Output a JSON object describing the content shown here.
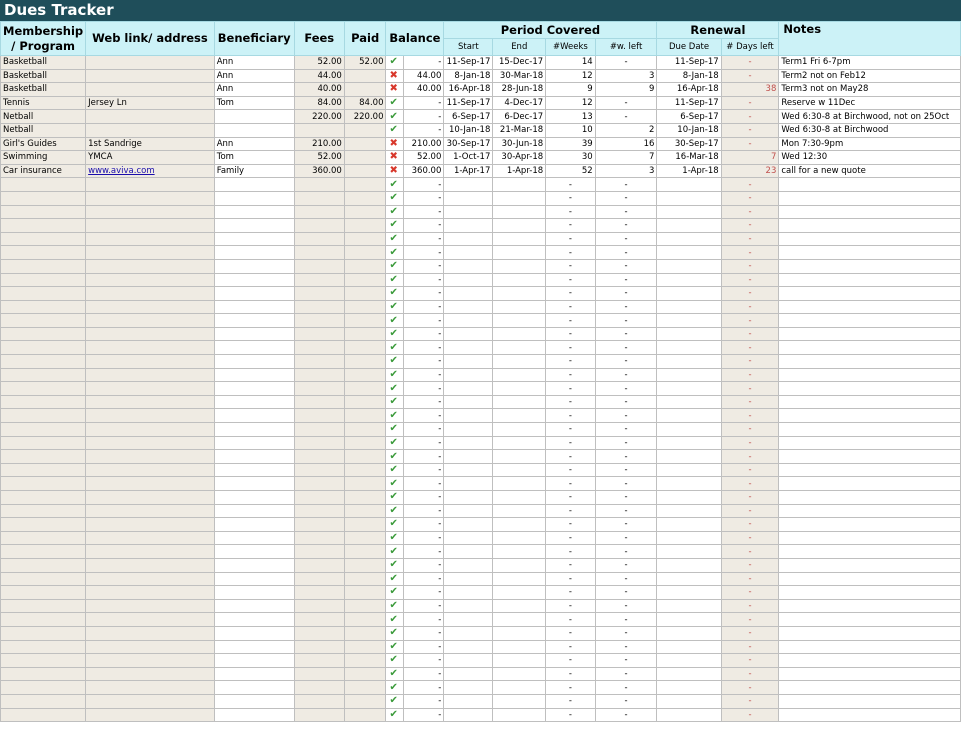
{
  "title": "Dues Tracker",
  "headers": {
    "membership": "Membership / Program",
    "web": "Web link/ address",
    "beneficiary": "Beneficiary",
    "fees": "Fees",
    "paid": "Paid",
    "balance": "Balance",
    "period": "Period Covered",
    "start": "Start",
    "end": "End",
    "weeks": "#Weeks",
    "wleft": "#w. left",
    "renewal": "Renewal",
    "due": "Due Date",
    "daysleft": "# Days left",
    "notes": "Notes"
  },
  "rows": [
    {
      "program": "Basketball",
      "web": "",
      "beneficiary": "Ann",
      "fees": "52.00",
      "paid": "52.00",
      "status": "check",
      "balance": "-",
      "start": "11-Sep-17",
      "end": "15-Dec-17",
      "weeks": "14",
      "wleft": "-",
      "due": "11-Sep-17",
      "days": "-",
      "notes": "Term1 Fri 6-7pm"
    },
    {
      "program": "Basketball",
      "web": "",
      "beneficiary": "Ann",
      "fees": "44.00",
      "paid": "",
      "status": "cross",
      "balance": "44.00",
      "start": "8-Jan-18",
      "end": "30-Mar-18",
      "weeks": "12",
      "wleft": "3",
      "due": "8-Jan-18",
      "days": "-",
      "notes": "Term2 not on Feb12"
    },
    {
      "program": "Basketball",
      "web": "",
      "beneficiary": "Ann",
      "fees": "40.00",
      "paid": "",
      "status": "cross",
      "balance": "40.00",
      "start": "16-Apr-18",
      "end": "28-Jun-18",
      "weeks": "9",
      "wleft": "9",
      "due": "16-Apr-18",
      "days": "38",
      "notes": "Term3 not on May28"
    },
    {
      "program": "Tennis",
      "web": "Jersey Ln",
      "beneficiary": "Tom",
      "fees": "84.00",
      "paid": "84.00",
      "status": "check",
      "balance": "-",
      "start": "11-Sep-17",
      "end": "4-Dec-17",
      "weeks": "12",
      "wleft": "-",
      "due": "11-Sep-17",
      "days": "-",
      "notes": "Reserve w 11Dec"
    },
    {
      "program": "Netball",
      "web": "",
      "beneficiary": "",
      "fees": "220.00",
      "paid": "220.00",
      "status": "check",
      "balance": "-",
      "start": "6-Sep-17",
      "end": "6-Dec-17",
      "weeks": "13",
      "wleft": "-",
      "due": "6-Sep-17",
      "days": "-",
      "notes": "Wed 6:30-8 at Birchwood, not on 25Oct"
    },
    {
      "program": "Netball",
      "web": "",
      "beneficiary": "",
      "fees": "",
      "paid": "",
      "status": "check",
      "balance": "-",
      "start": "10-Jan-18",
      "end": "21-Mar-18",
      "weeks": "10",
      "wleft": "2",
      "due": "10-Jan-18",
      "days": "-",
      "notes": "Wed 6:30-8 at Birchwood"
    },
    {
      "program": "Girl's Guides",
      "web": "1st Sandrige",
      "beneficiary": "Ann",
      "fees": "210.00",
      "paid": "",
      "status": "cross",
      "balance": "210.00",
      "start": "30-Sep-17",
      "end": "30-Jun-18",
      "weeks": "39",
      "wleft": "16",
      "due": "30-Sep-17",
      "days": "-",
      "notes": "Mon 7:30-9pm"
    },
    {
      "program": "Swimming",
      "web": "YMCA",
      "beneficiary": "Tom",
      "fees": "52.00",
      "paid": "",
      "status": "cross",
      "balance": "52.00",
      "start": "1-Oct-17",
      "end": "30-Apr-18",
      "weeks": "30",
      "wleft": "7",
      "due": "16-Mar-18",
      "days": "7",
      "notes": "Wed 12:30"
    },
    {
      "program": "Car insurance",
      "web": "www.aviva.com",
      "link": true,
      "beneficiary": "Family",
      "fees": "360.00",
      "paid": "",
      "status": "cross",
      "balance": "360.00",
      "start": "1-Apr-17",
      "end": "1-Apr-18",
      "weeks": "52",
      "wleft": "3",
      "due": "1-Apr-18",
      "days": "23",
      "notes": "call for a new quote"
    }
  ],
  "empty_row_count": 40,
  "empty_placeholder": "-",
  "colors": {
    "title_bg": "#1f4e5a",
    "header_bg": "#ccf2f7",
    "tan": "#efebe3",
    "check": "#3a9a3a",
    "cross": "#d8382c",
    "days_warn": "#c0504d"
  }
}
